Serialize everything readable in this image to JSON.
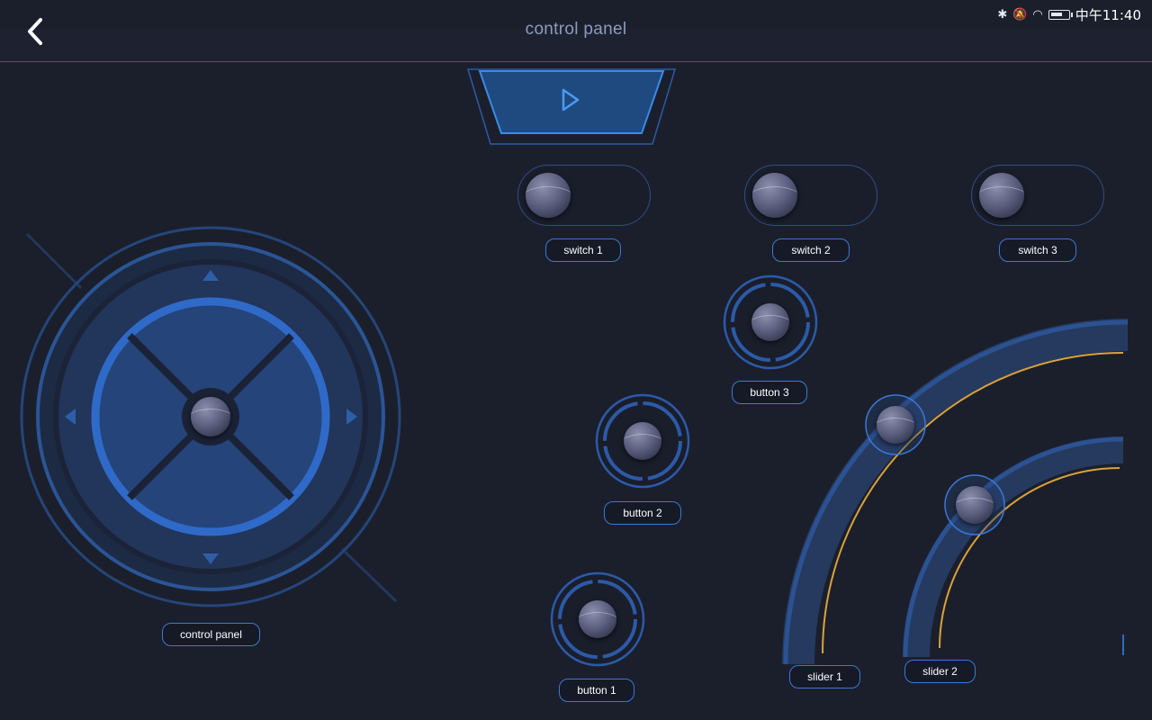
{
  "status_bar": {
    "time": "中午11:40"
  },
  "header": {
    "title": "control panel"
  },
  "joystick": {
    "label": "control panel"
  },
  "switches": [
    {
      "label": "switch 1"
    },
    {
      "label": "switch 2"
    },
    {
      "label": "switch 3"
    }
  ],
  "buttons": [
    {
      "label": "button 1"
    },
    {
      "label": "button 2"
    },
    {
      "label": "button 3"
    }
  ],
  "sliders": [
    {
      "label": "slider 1"
    },
    {
      "label": "slider 2"
    }
  ],
  "colors": {
    "background": "#1b1f2c",
    "accent_blue": "#3a78d8",
    "accent_gold": "#d9a23a",
    "title_text": "#8c9cbe"
  },
  "icons": [
    "back-arrow-icon",
    "play-icon",
    "bluetooth-icon",
    "mute-icon",
    "wifi-icon",
    "battery-icon"
  ]
}
